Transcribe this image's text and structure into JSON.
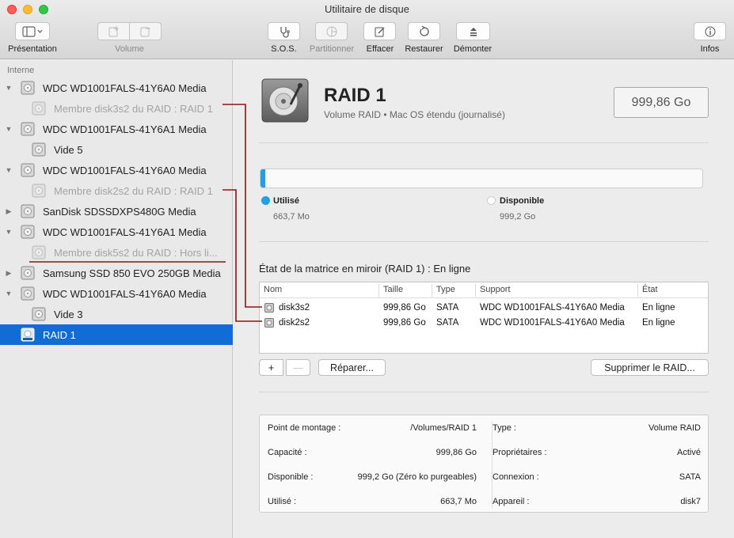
{
  "window": {
    "title": "Utilitaire de disque"
  },
  "toolbar": {
    "presentation": "Présentation",
    "volume": "Volume",
    "sos": "S.O.S.",
    "partition": "Partitionner",
    "effacer": "Effacer",
    "restaurer": "Restaurer",
    "demonter": "Démonter",
    "infos": "Infos"
  },
  "sidebar": {
    "header": "Interne",
    "items": [
      {
        "label": "WDC WD1001FALS-41Y6A0 Media",
        "icon": "hard-disk-icon"
      },
      {
        "label": "Membre disk3s2 du RAID : RAID 1",
        "icon": "volume-icon"
      },
      {
        "label": "WDC WD1001FALS-41Y6A1 Media",
        "icon": "hard-disk-icon"
      },
      {
        "label": "Vide 5",
        "icon": "volume-icon"
      },
      {
        "label": "WDC WD1001FALS-41Y6A0 Media",
        "icon": "hard-disk-icon"
      },
      {
        "label": "Membre disk2s2 du RAID : RAID 1",
        "icon": "volume-icon"
      },
      {
        "label": "SanDisk SDSSDXPS480G Media",
        "icon": "hard-disk-icon"
      },
      {
        "label": "WDC WD1001FALS-41Y6A1 Media",
        "icon": "hard-disk-icon"
      },
      {
        "label": "Membre disk5s2 du RAID : Hors li...",
        "icon": "volume-icon"
      },
      {
        "label": "Samsung SSD 850 EVO 250GB Media",
        "icon": "hard-disk-icon"
      },
      {
        "label": "WDC WD1001FALS-41Y6A0 Media",
        "icon": "hard-disk-icon"
      },
      {
        "label": "Vide 3",
        "icon": "volume-icon"
      },
      {
        "label": "RAID 1",
        "icon": "raid-volume-icon"
      }
    ]
  },
  "volume": {
    "name": "RAID 1",
    "subtitle": "Volume RAID • Mac OS étendu (journalisé)",
    "size": "999,86 Go"
  },
  "usage": {
    "used_label": "Utilisé",
    "used_value": "663,7 Mo",
    "free_label": "Disponible",
    "free_value": "999,2 Go",
    "used_color": "#1da1e9",
    "used_fraction": 0.00066
  },
  "mirror": {
    "title": "État de la matrice en miroir (RAID 1) : En ligne",
    "columns": [
      "Nom",
      "Taille",
      "Type",
      "Support",
      "État"
    ],
    "rows": [
      {
        "nom": "disk3s2",
        "taille": "999,86 Go",
        "type": "SATA",
        "support": "WDC WD1001FALS-41Y6A0 Media",
        "etat": "En ligne"
      },
      {
        "nom": "disk2s2",
        "taille": "999,86 Go",
        "type": "SATA",
        "support": "WDC WD1001FALS-41Y6A0 Media",
        "etat": "En ligne"
      }
    ]
  },
  "actions": {
    "add": "+",
    "remove": "—",
    "repair": "Réparer...",
    "delete": "Supprimer le RAID..."
  },
  "info": {
    "left": [
      {
        "k": "Point de montage :",
        "v": "/Volumes/RAID 1"
      },
      {
        "k": "Capacité :",
        "v": "999,86 Go"
      },
      {
        "k": "Disponible :",
        "v": "999,2 Go (Zéro ko purgeables)"
      },
      {
        "k": "Utilisé :",
        "v": "663,7 Mo"
      }
    ],
    "right": [
      {
        "k": "Type :",
        "v": "Volume RAID"
      },
      {
        "k": "Propriétaires :",
        "v": "Activé"
      },
      {
        "k": "Connexion :",
        "v": "SATA"
      },
      {
        "k": "Appareil :",
        "v": "disk7"
      }
    ]
  },
  "colors": {
    "selection": "#116cd6",
    "connector": "#8b1414"
  }
}
